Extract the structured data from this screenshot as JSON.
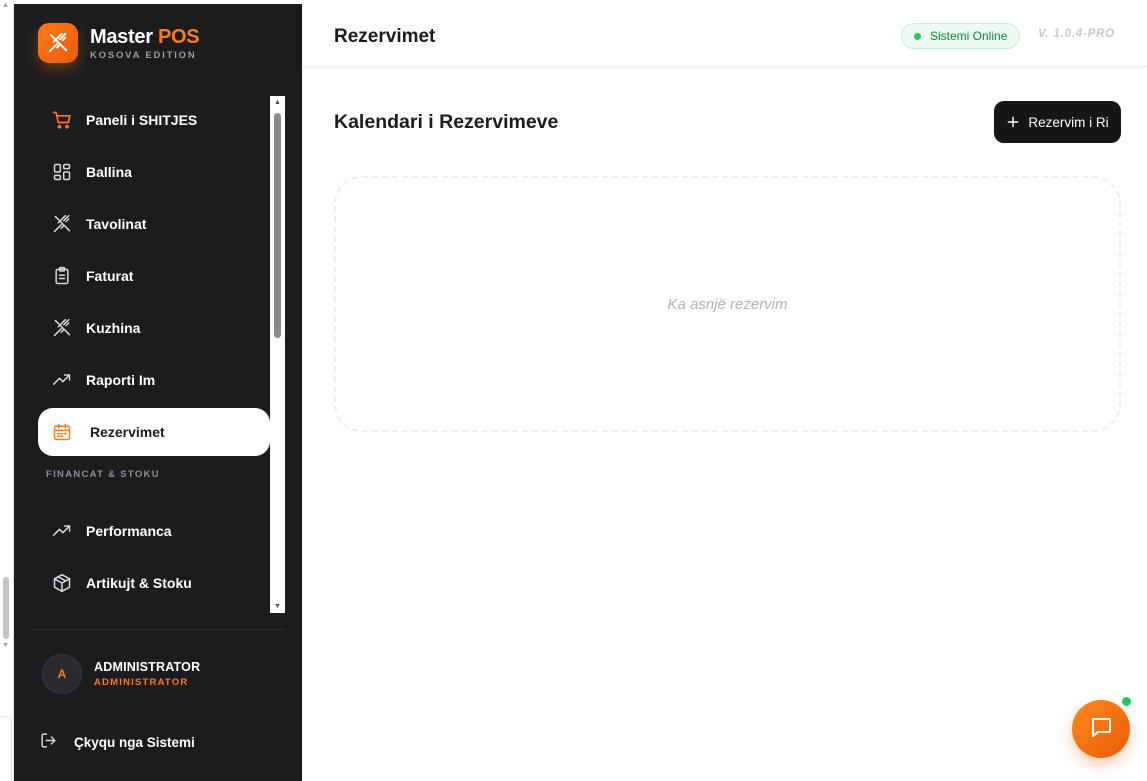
{
  "brand": {
    "title": "Master",
    "title_accent": "POS",
    "subtitle": "KOSOVA EDITION"
  },
  "sidebar": {
    "items": [
      {
        "label": "Paneli i SHITJES",
        "icon": "cart-icon"
      },
      {
        "label": "Ballina",
        "icon": "grid-icon"
      },
      {
        "label": "Tavolinat",
        "icon": "utensils-icon"
      },
      {
        "label": "Faturat",
        "icon": "clipboard-icon"
      },
      {
        "label": "Kuzhina",
        "icon": "utensils-icon"
      },
      {
        "label": "Raporti Im",
        "icon": "trending-up-icon"
      },
      {
        "label": "Rezervimet",
        "icon": "calendar-icon",
        "active": true
      }
    ],
    "section_label": "FINANCAT & STOKU",
    "section_items": [
      {
        "label": "Performanca",
        "icon": "trending-up-icon"
      },
      {
        "label": "Artikujt & Stoku",
        "icon": "package-icon"
      }
    ]
  },
  "user": {
    "initial": "A",
    "name": "ADMINISTRATOR",
    "role": "ADMINISTRATOR"
  },
  "logout": {
    "label": "Çkyqu nga Sistemi"
  },
  "header": {
    "title": "Rezervimet",
    "status": "Sistemi Online",
    "version": "V. 1.0.4-PRO"
  },
  "main": {
    "section_title": "Kalendari i Rezervimeve",
    "new_button": "Rezervim i Ri",
    "empty_message": "Ka asnjë rezervim"
  },
  "colors": {
    "accent": "#ff7a1a",
    "sidebar_bg": "#1c1c1f",
    "status_green": "#22c55e",
    "button_dark": "#161618"
  }
}
